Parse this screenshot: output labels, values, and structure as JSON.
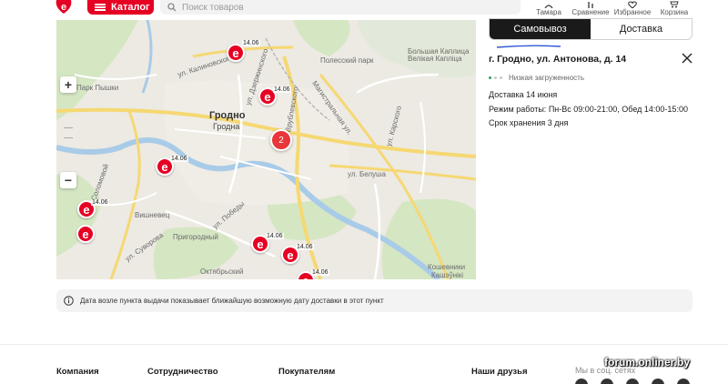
{
  "header": {
    "catalog_label": "Каталог",
    "search_placeholder": "Поиск товаров",
    "items": [
      {
        "label": "Тамара",
        "icon": "user-icon"
      },
      {
        "label": "Сравнение",
        "icon": "compare-icon"
      },
      {
        "label": "Избранное",
        "icon": "heart-icon"
      },
      {
        "label": "Корзина",
        "icon": "cart-icon"
      }
    ]
  },
  "map": {
    "city": "Гродно",
    "city_alt": "Гродна",
    "cluster_count": "2",
    "labels": [
      "Парк Пышки",
      "Полесский парк",
      "Большая Каплица",
      "Велікая Капліца",
      "ул. Калиновского",
      "ул. Дзержинского",
      "Магистральная ул.",
      "ул. Белуша",
      "ул. Карского",
      "ул. Суворова",
      "ул. Соломовой",
      "Пригородный",
      "Октябрьский",
      "Кошевники",
      "Кашэўнікі",
      "Вишневец",
      "ул. Победы",
      "ул. Врублевского"
    ],
    "markers": [
      {
        "glyph": "e",
        "date": "14.06"
      },
      {
        "glyph": "e",
        "date": "14.06"
      },
      {
        "glyph": "e",
        "date": "14.06"
      },
      {
        "glyph": "e",
        "date": "14.06"
      },
      {
        "glyph": "e",
        "date": ""
      },
      {
        "glyph": "e",
        "date": "14.06"
      },
      {
        "glyph": "e",
        "date": "14.06"
      },
      {
        "glyph": "e",
        "date": "14.06"
      }
    ],
    "zoom_in": "+",
    "zoom_out": "−"
  },
  "panel": {
    "tab_pickup": "Самовывоз",
    "tab_delivery": "Доставка",
    "address": "г. Гродно, ул. Антонова, д. 14",
    "load_status": "Низкая загруженность",
    "delivery": "Доставка 14 июня",
    "hours": "Режим работы: Пн-Вс 09:00-21:00, Обед 14:00-15:00",
    "storage": "Срок хранения 3 дня"
  },
  "note": "Дата возле пункта выдачи показывает ближайшую возможную дату доставки в этот пункт",
  "footer": {
    "company": "Компания",
    "partnership": "Сотрудничество",
    "buyers": "Покупателям",
    "friends": "Наши друзья",
    "social": "Мы в соц. сетях"
  },
  "watermark": "forum.onliner.by",
  "colors": {
    "accent": "#e60023",
    "active_tab": "#1a1a1a",
    "ok": "#26a65b"
  }
}
